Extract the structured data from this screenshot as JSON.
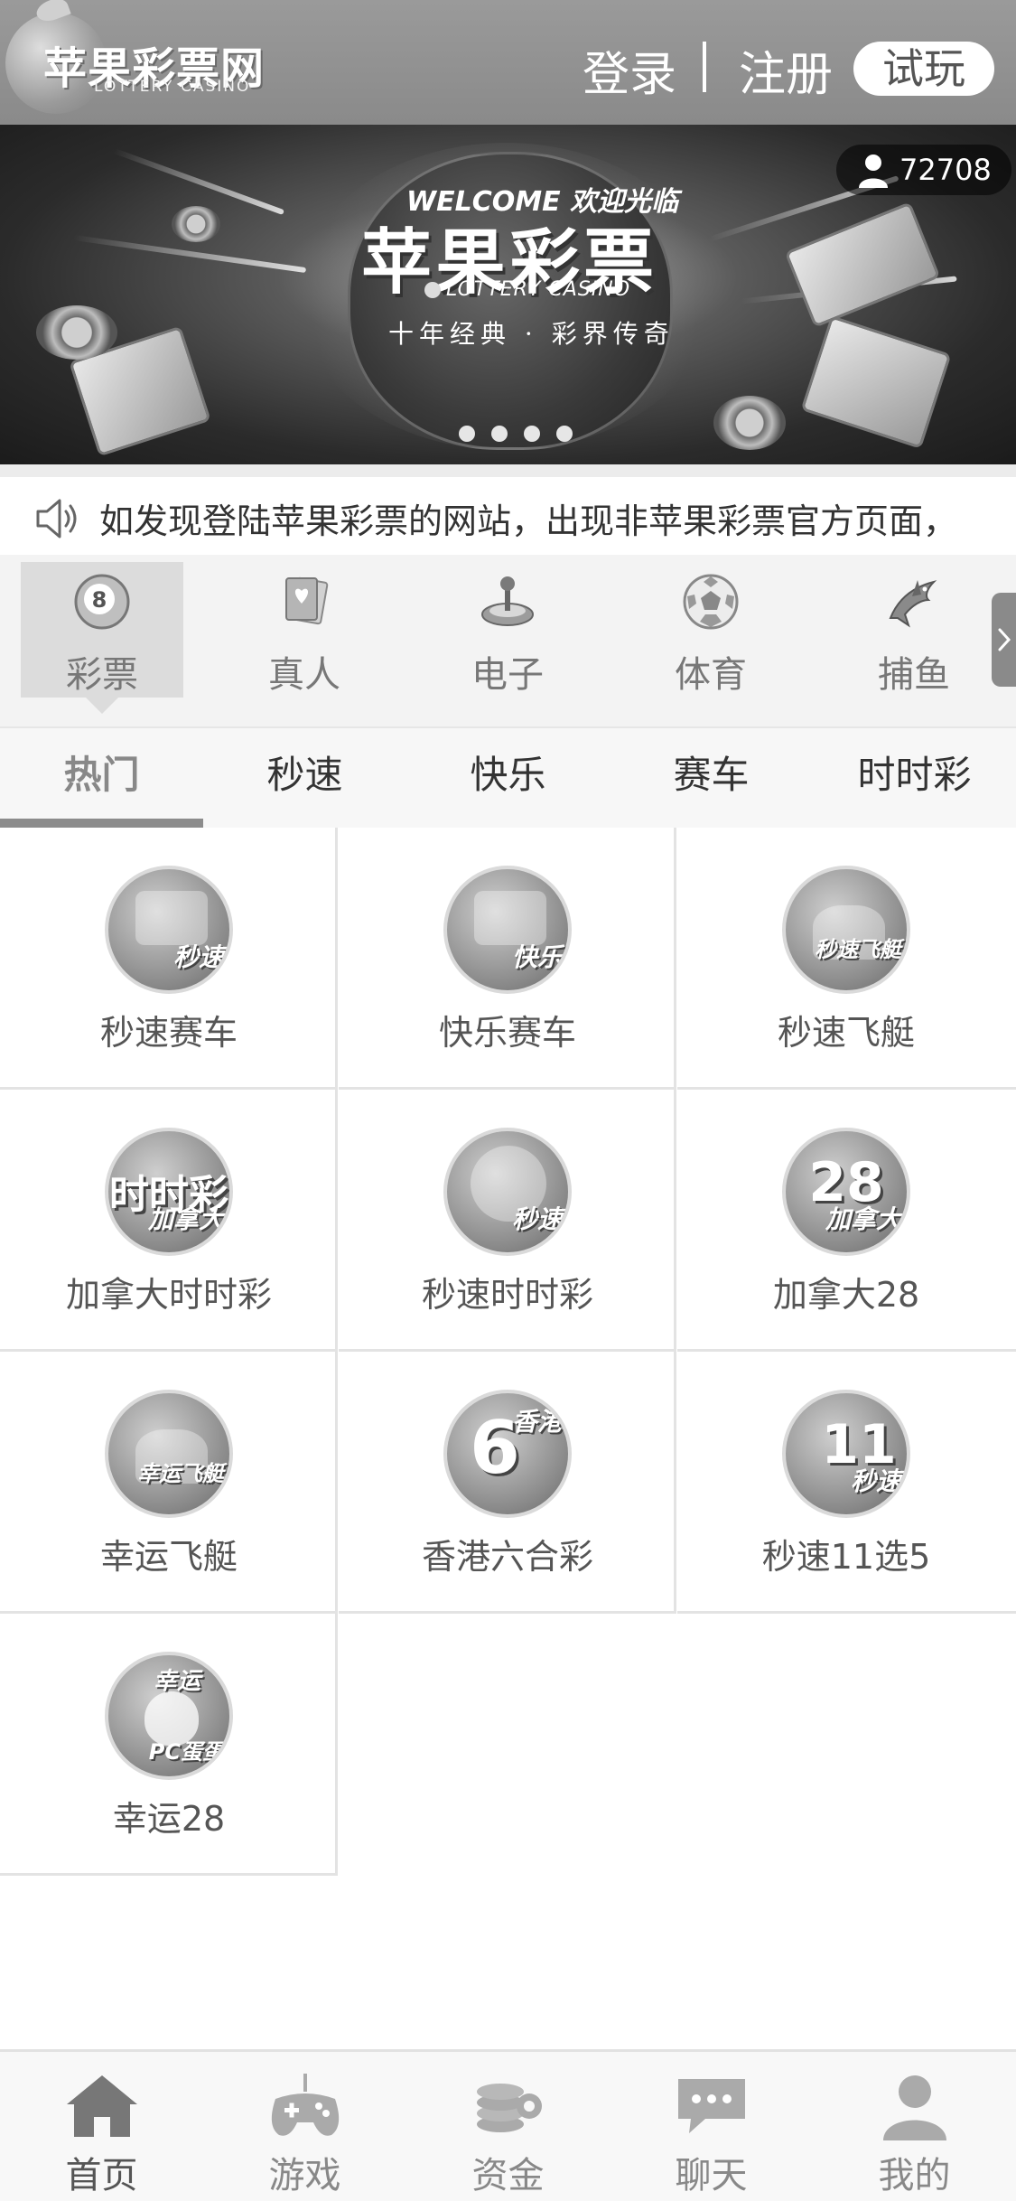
{
  "header": {
    "logo_cn": "苹果彩票网",
    "logo_en": "LOTTERY CASINO",
    "login_label": "登录",
    "register_label": "注册",
    "trial_label": "试玩"
  },
  "banner": {
    "welcome": "WELCOME 欢迎光临",
    "title": "苹果彩票",
    "subtitle": "LOTTERY CASINO",
    "slogan": "十年经典 · 彩界传奇",
    "online_count": "72708",
    "slide_count": 4
  },
  "notice": {
    "text": "如发现登陆苹果彩票的网站，出现非苹果彩票官方页面，"
  },
  "categories": [
    {
      "label": "彩票",
      "icon": "lottery-ball-icon",
      "active": true
    },
    {
      "label": "真人",
      "icon": "playing-cards-icon",
      "active": false
    },
    {
      "label": "电子",
      "icon": "joystick-icon",
      "active": false
    },
    {
      "label": "体育",
      "icon": "soccer-ball-icon",
      "active": false
    },
    {
      "label": "捕鱼",
      "icon": "shark-icon",
      "active": false
    }
  ],
  "tabs": [
    {
      "label": "热门",
      "active": true
    },
    {
      "label": "秒速",
      "active": false
    },
    {
      "label": "快乐",
      "active": false
    },
    {
      "label": "赛车",
      "active": false
    },
    {
      "label": "时时彩",
      "active": false
    }
  ],
  "games": [
    {
      "label": "秒速赛车",
      "icon_text": "秒速",
      "icon": "race-car-icon"
    },
    {
      "label": "快乐赛车",
      "icon_text": "快乐",
      "icon": "race-car-icon"
    },
    {
      "label": "秒速飞艇",
      "icon_text": "秒速飞艇",
      "icon": "jet-ski-icon"
    },
    {
      "label": "加拿大时时彩",
      "icon_text": "加拿大",
      "icon": "ssc-icon"
    },
    {
      "label": "秒速时时彩",
      "icon_text": "秒速",
      "icon": "stopwatch-icon"
    },
    {
      "label": "加拿大28",
      "icon_text": "加拿大",
      "icon_big": "28",
      "icon": "ball-28-icon"
    },
    {
      "label": "幸运飞艇",
      "icon_text": "幸运飞艇",
      "icon": "jet-ski-icon"
    },
    {
      "label": "香港六合彩",
      "icon_text": "香港",
      "icon_big": "6",
      "icon": "mark-six-icon"
    },
    {
      "label": "秒速11选5",
      "icon_text": "秒速",
      "icon_big": "11",
      "icon": "eleven-five-icon"
    },
    {
      "label": "幸运28",
      "icon_text": "PC蛋蛋",
      "icon_top": "幸运",
      "icon": "pc-egg-icon"
    }
  ],
  "bottom_nav": [
    {
      "label": "首页",
      "icon": "home-icon",
      "active": true
    },
    {
      "label": "游戏",
      "icon": "gamepad-icon",
      "active": false
    },
    {
      "label": "资金",
      "icon": "coins-icon",
      "active": false
    },
    {
      "label": "聊天",
      "icon": "chat-icon",
      "active": false
    },
    {
      "label": "我的",
      "icon": "user-icon",
      "active": false
    }
  ],
  "colors": {
    "header_bg": "#8f8f8f",
    "active_tab_underline": "#8c8c8c",
    "active_category_bg": "#dcdcdc"
  }
}
